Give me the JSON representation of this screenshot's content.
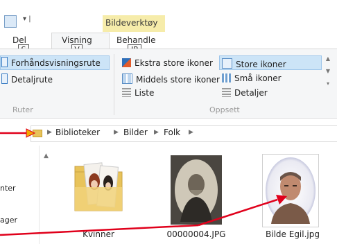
{
  "ribbon": {
    "context_tab": "Bildeverktøy",
    "tabs": [
      {
        "label": "Del",
        "keytip": "S"
      },
      {
        "label": "Visning",
        "keytip": "V"
      },
      {
        "label": "Behandle",
        "keytip": "JP"
      }
    ],
    "panes": {
      "items": [
        "Forhåndsvisningsrute",
        "Detaljrute"
      ],
      "group_label": "Ruter"
    },
    "layout": {
      "col1": [
        "Ekstra store ikoner",
        "Middels store ikoner",
        "Liste"
      ],
      "col2": [
        "Store ikoner",
        "Små ikoner",
        "Detaljer"
      ],
      "group_label": "Oppsett"
    }
  },
  "address": {
    "crumbs": [
      "Biblioteker",
      "Bilder",
      "Folk"
    ]
  },
  "nav": {
    "items": [
      "nter",
      "ager"
    ]
  },
  "files": [
    {
      "name": "Kvinner",
      "type": "folder"
    },
    {
      "name": "00000004.JPG",
      "type": "photo-old"
    },
    {
      "name": "Bilde Egil.jpg",
      "type": "photo-portrait"
    }
  ],
  "colors": {
    "annotation": "#e0001b",
    "arrow_accent": "#f2a900",
    "selection": "#cce4f7",
    "context_header": "#f6ecaa"
  }
}
